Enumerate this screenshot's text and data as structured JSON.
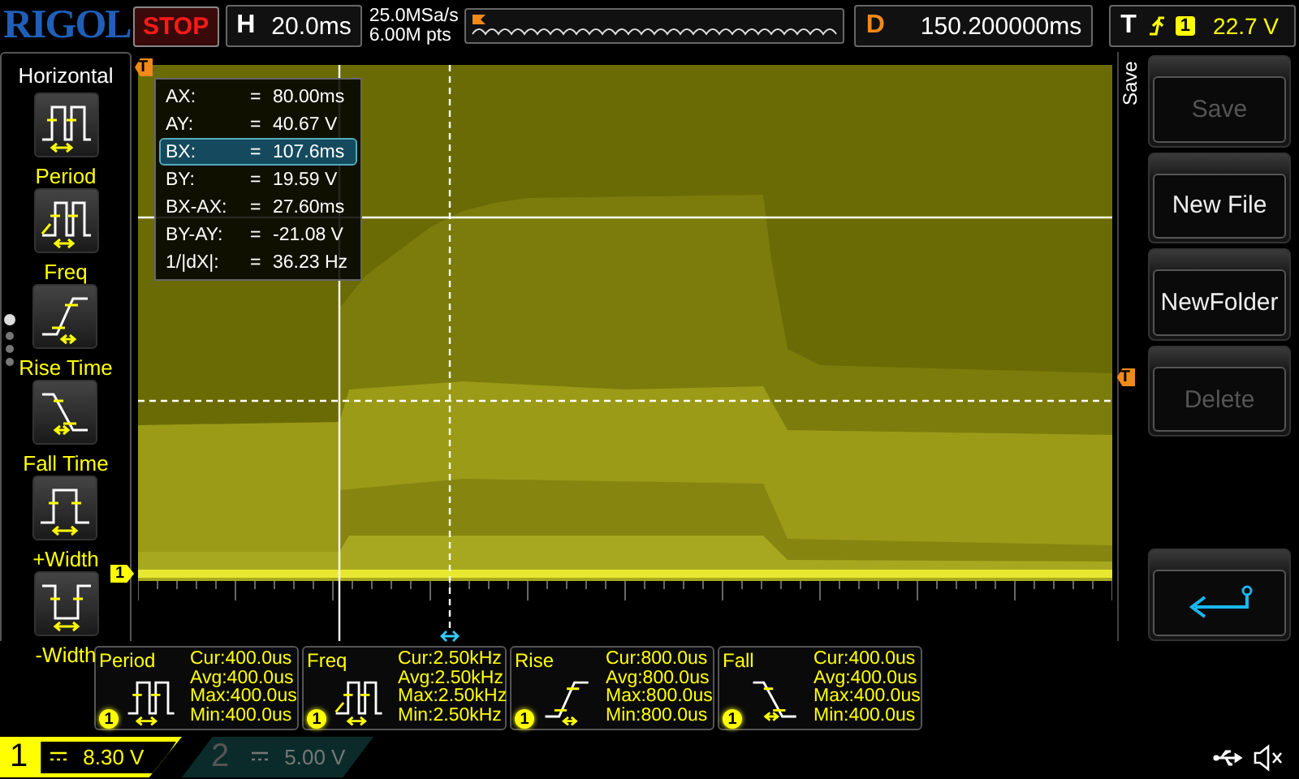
{
  "header": {
    "logo": "RIGOL",
    "run_state": "STOP",
    "timebase_label": "H",
    "timebase": "20.0ms",
    "sample_rate": "25.0MSa/s",
    "memory_depth": "6.00M pts",
    "delay_label": "D",
    "delay": "150.200000ms",
    "trigger_label": "T",
    "trigger_channel": "1",
    "trigger_level": "22.7 V"
  },
  "measure_menu": {
    "title": "Horizontal",
    "items": [
      {
        "label": "Period",
        "kind": "period"
      },
      {
        "label": "Freq",
        "kind": "freq"
      },
      {
        "label": "Rise Time",
        "kind": "rise"
      },
      {
        "label": "Fall Time",
        "kind": "fall"
      },
      {
        "label": "+Width",
        "kind": "pwidth"
      },
      {
        "label": "-Width",
        "kind": "nwidth"
      }
    ]
  },
  "plot": {
    "trigger_position_marker": "T",
    "trigger_level_marker": "T",
    "channel_marker": "1"
  },
  "cursor_readout": {
    "rows": [
      {
        "label": "AX:",
        "equals": "=",
        "value": "80.00ms",
        "selected": false
      },
      {
        "label": "AY:",
        "equals": "=",
        "value": "40.67 V",
        "selected": false
      },
      {
        "label": "BX:",
        "equals": "=",
        "value": "107.6ms",
        "selected": true
      },
      {
        "label": "BY:",
        "equals": "=",
        "value": "19.59 V",
        "selected": false
      },
      {
        "label": "BX-AX:",
        "equals": "=",
        "value": "27.60ms",
        "selected": false
      },
      {
        "label": "BY-AY:",
        "equals": "=",
        "value": "-21.08 V",
        "selected": false
      },
      {
        "label": "1/|dX|:",
        "equals": "=",
        "value": "36.23 Hz",
        "selected": false
      }
    ]
  },
  "softkey_menu": {
    "title": "Save",
    "buttons": [
      {
        "kind": "text",
        "label": "Save",
        "disabled": true
      },
      {
        "kind": "text",
        "label": "New File",
        "disabled": false
      },
      {
        "kind": "text",
        "label": "NewFolder",
        "disabled": false
      },
      {
        "kind": "text",
        "label": "Delete",
        "disabled": true
      },
      {
        "kind": "back",
        "disabled": false
      }
    ]
  },
  "measurements": [
    {
      "name": "Period",
      "channel": "1",
      "kind": "period",
      "stats": [
        "Cur:400.0us",
        "Avg:400.0us",
        "Max:400.0us",
        "Min:400.0us"
      ]
    },
    {
      "name": "Freq",
      "channel": "1",
      "kind": "freq",
      "stats": [
        "Cur:2.50kHz",
        "Avg:2.50kHz",
        "Max:2.50kHz",
        "Min:2.50kHz"
      ]
    },
    {
      "name": "Rise",
      "channel": "1",
      "kind": "rise",
      "stats": [
        "Cur:800.0us",
        "Avg:800.0us",
        "Max:800.0us",
        "Min:800.0us"
      ]
    },
    {
      "name": "Fall",
      "channel": "1",
      "kind": "fall",
      "stats": [
        "Cur:400.0us",
        "Avg:400.0us",
        "Max:400.0us",
        "Min:400.0us"
      ]
    }
  ],
  "channels": [
    {
      "number": "1",
      "scale": "8.30 V",
      "selected": true
    },
    {
      "number": "2",
      "scale": "5.00 V",
      "selected": false
    }
  ]
}
